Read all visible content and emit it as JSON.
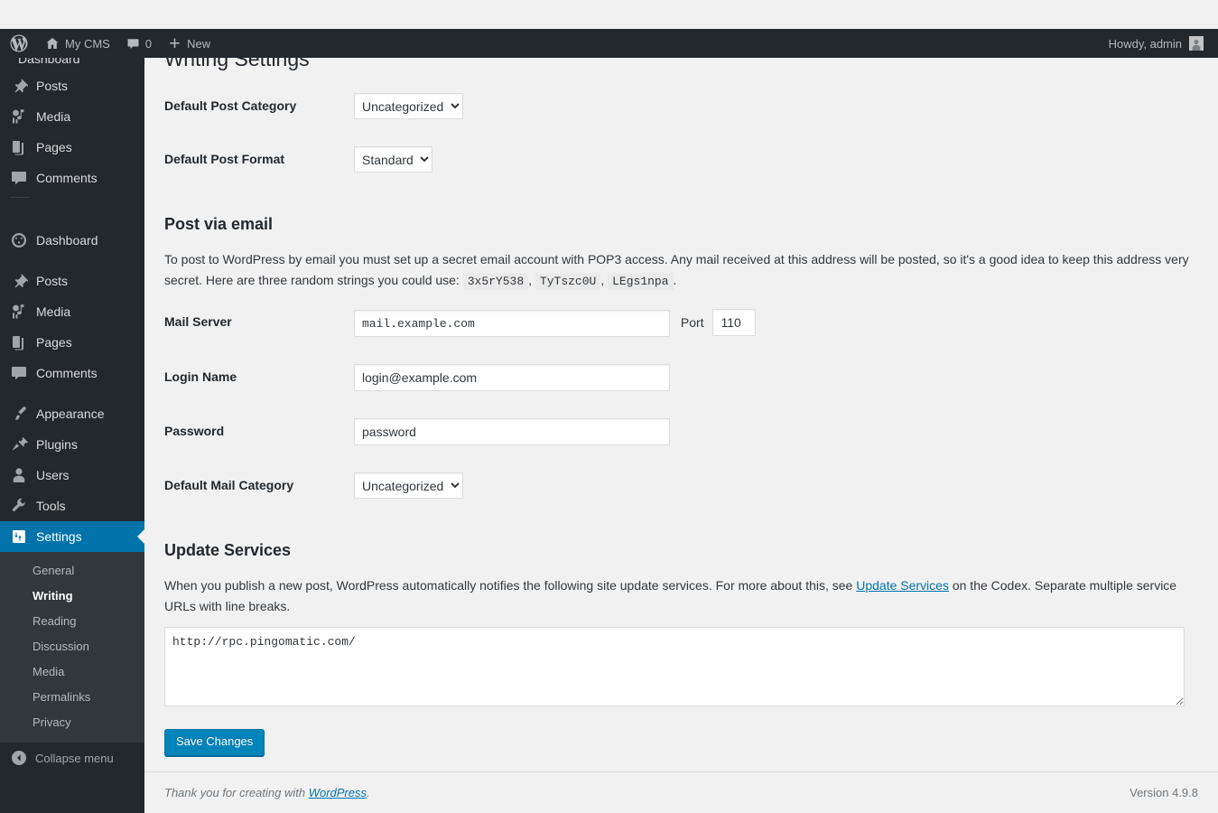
{
  "adminbar": {
    "logo_icon": "wordpress-logo-icon",
    "site_name": "My CMS",
    "home_icon": "home-icon",
    "comments_icon": "comment-bubble-icon",
    "comments_count": "0",
    "new_icon": "plus-icon",
    "new_label": "New",
    "howdy": "Howdy, admin",
    "avatar_icon": "avatar-icon"
  },
  "sidebar": {
    "ghost_label": "Dashboard",
    "items": [
      {
        "label": "Posts",
        "icon": "pin-icon"
      },
      {
        "label": "Media",
        "icon": "media-icon"
      },
      {
        "label": "Pages",
        "icon": "pages-icon"
      },
      {
        "label": "Comments",
        "icon": "comment-bubble-icon"
      }
    ],
    "items2": [
      {
        "label": "Dashboard",
        "icon": "dashboard-gauge-icon"
      },
      {
        "label": "Posts",
        "icon": "pin-icon"
      },
      {
        "label": "Media",
        "icon": "media-icon"
      },
      {
        "label": "Pages",
        "icon": "pages-icon"
      },
      {
        "label": "Comments",
        "icon": "comment-bubble-icon"
      }
    ],
    "items3": [
      {
        "label": "Appearance",
        "icon": "paintbrush-icon"
      },
      {
        "label": "Plugins",
        "icon": "plug-icon"
      },
      {
        "label": "Users",
        "icon": "user-icon"
      },
      {
        "label": "Tools",
        "icon": "wrench-icon"
      }
    ],
    "settings": {
      "label": "Settings",
      "icon": "settings-sliders-icon"
    },
    "submenu": [
      "General",
      "Writing",
      "Reading",
      "Discussion",
      "Media",
      "Permalinks",
      "Privacy"
    ],
    "submenu_current": "Writing",
    "collapse": {
      "label": "Collapse menu",
      "icon": "collapse-arrow-icon"
    },
    "accent_color": "#0073aa"
  },
  "main": {
    "page_title": "Writing Settings",
    "fields": {
      "default_post_category_label": "Default Post Category",
      "default_post_category_value": "Uncategorized",
      "default_post_format_label": "Default Post Format",
      "default_post_format_value": "Standard",
      "mail_server_label": "Mail Server",
      "mail_server_value": "mail.example.com",
      "port_label": "Port",
      "port_value": "110",
      "login_name_label": "Login Name",
      "login_name_value": "login@example.com",
      "password_label": "Password",
      "password_value": "password",
      "default_mail_category_label": "Default Mail Category",
      "default_mail_category_value": "Uncategorized"
    },
    "post_via_email": {
      "title": "Post via email",
      "desc_1": "To post to WordPress by email you must set up a secret email account with POP3 access. Any mail received at this address will be posted, so it's a good idea to keep this address very secret. Here are three random strings you could use:",
      "code_1": "3x5rY538",
      "code_2": "TyTszc0U",
      "code_3": "LEgs1npa",
      "sep": ",",
      "end": "."
    },
    "update_services": {
      "title": "Update Services",
      "desc_before": "When you publish a new post, WordPress automatically notifies the following site update services. For more about this, see ",
      "link_text": "Update Services",
      "desc_after": " on the Codex. Separate multiple service URLs with line breaks.",
      "textarea_value": "http://rpc.pingomatic.com/"
    },
    "save_label": "Save Changes"
  },
  "footer": {
    "thanks_before": "Thank you for creating with ",
    "thanks_link": "WordPress",
    "thanks_after": ".",
    "version": "Version 4.9.8"
  },
  "select_options": {
    "category": [
      "Uncategorized"
    ],
    "format": [
      "Standard"
    ]
  }
}
